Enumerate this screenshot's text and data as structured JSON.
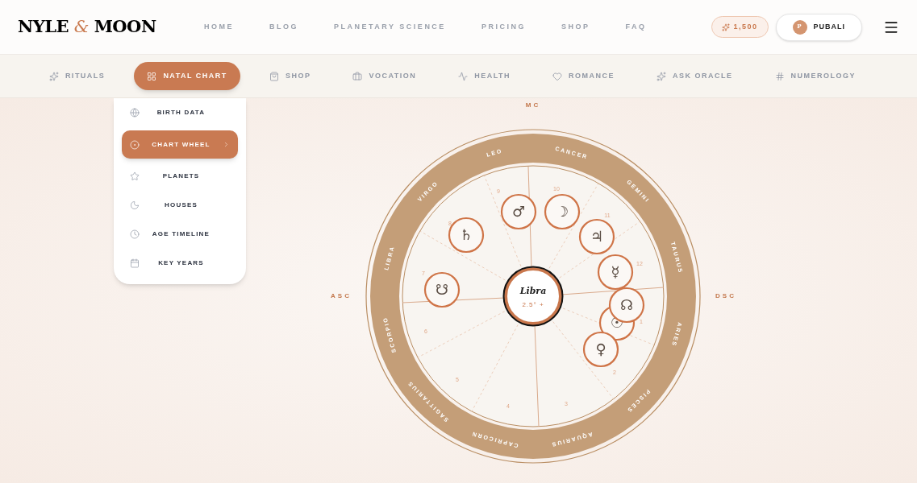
{
  "header": {
    "logo": {
      "left": "NYLE",
      "amp": "&",
      "right": "MOON"
    },
    "nav": [
      "HOME",
      "BLOG",
      "PLANETARY SCIENCE",
      "PRICING",
      "SHOP",
      "FAQ"
    ],
    "points": "1,500",
    "user": {
      "initial": "P",
      "name": "PUBALI"
    }
  },
  "tabs": [
    {
      "label": "RITUALS",
      "selected": false
    },
    {
      "label": "NATAL CHART",
      "selected": true
    },
    {
      "label": "SHOP",
      "selected": false
    },
    {
      "label": "VOCATION",
      "selected": false
    },
    {
      "label": "HEALTH",
      "selected": false
    },
    {
      "label": "ROMANCE",
      "selected": false
    },
    {
      "label": "ASK ORACLE",
      "selected": false
    },
    {
      "label": "NUMEROLOGY",
      "selected": false
    }
  ],
  "menu": {
    "items": [
      {
        "label": "BIRTH DATA",
        "selected": false
      },
      {
        "label": "CHART WHEEL",
        "selected": true
      },
      {
        "label": "PLANETS",
        "selected": false
      },
      {
        "label": "HOUSES",
        "selected": false
      },
      {
        "label": "AGE TIMELINE",
        "selected": false
      },
      {
        "label": "KEY YEARS",
        "selected": false
      }
    ]
  },
  "chart": {
    "axes": {
      "mc": "MC",
      "asc": "ASC",
      "dsc": "DSC"
    },
    "signs": [
      "CANCER",
      "GEMINI",
      "TAURUS",
      "ARIES",
      "PISCES",
      "AQUARIUS",
      "CAPRICORN",
      "SAGITTARIUS",
      "SCORPIO",
      "LIBRA",
      "VIRGO",
      "LEO"
    ],
    "houses": [
      "9",
      "10",
      "11",
      "12",
      "1",
      "2",
      "3",
      "4",
      "5",
      "6",
      "7",
      "8"
    ],
    "planets": [
      "♂",
      "☽",
      "♃",
      "☿",
      "☉",
      "☊",
      "♀",
      "♄",
      "☋"
    ],
    "center": {
      "sign": "Libra",
      "degree": "2.5° +"
    }
  }
}
